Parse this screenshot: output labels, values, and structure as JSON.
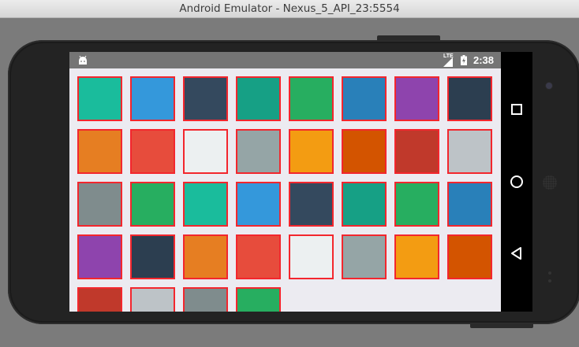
{
  "window": {
    "title": "Android Emulator - Nexus_5_API_23:5554"
  },
  "statusbar": {
    "time": "2:38",
    "network": "LTE"
  },
  "colors": {
    "tile_border": "#f3262d",
    "screen_background": "#ecebf1",
    "statusbar_background": "#757575"
  },
  "tiles": [
    "#1abc9c",
    "#3498db",
    "#34495e",
    "#16a085",
    "#27ae60",
    "#2980b9",
    "#8e44ad",
    "#2c3e50",
    "#e67e22",
    "#e74c3c",
    "#ecf0f1",
    "#95a5a6",
    "#f39c12",
    "#d35400",
    "#c0392b",
    "#bdc3c7",
    "#7f8c8d",
    "#27ae60",
    "#1abc9c",
    "#3498db",
    "#34495e",
    "#16a085",
    "#27ae60",
    "#2980b9",
    "#8e44ad",
    "#2c3e50",
    "#e67e22",
    "#e74c3c",
    "#ecf0f1",
    "#95a5a6",
    "#f39c12",
    "#d35400",
    "#c0392b",
    "#bdc3c7",
    "#7f8c8d",
    "#27ae60"
  ],
  "navbar": {
    "icons": [
      "overview-square-icon",
      "home-circle-icon",
      "back-triangle-icon"
    ]
  }
}
